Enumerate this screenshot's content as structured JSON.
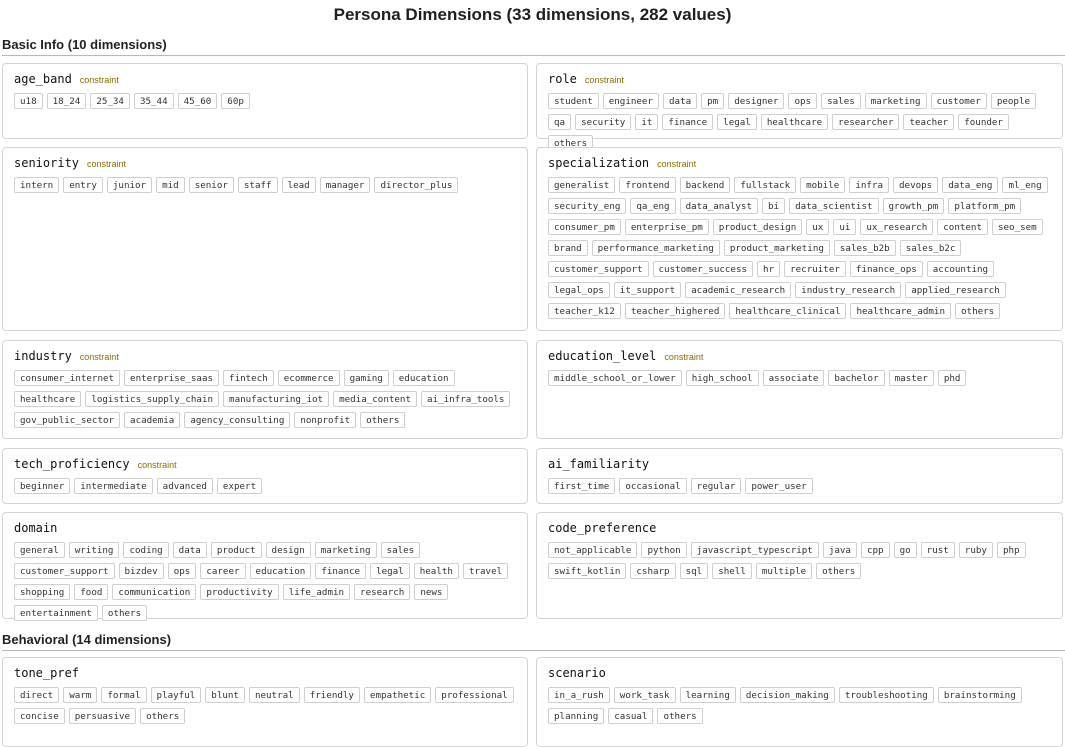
{
  "title": "Persona Dimensions (33 dimensions, 282 values)",
  "sections": [
    {
      "label": "Basic Info (10 dimensions)",
      "rows": [
        [
          {
            "name": "age_band",
            "constraint": "constraint",
            "values": [
              "u18",
              "18_24",
              "25_34",
              "35_44",
              "45_60",
              "60p"
            ]
          },
          {
            "name": "role",
            "constraint": "constraint",
            "values": [
              "student",
              "engineer",
              "data",
              "pm",
              "designer",
              "ops",
              "sales",
              "marketing",
              "customer",
              "people",
              "qa",
              "security",
              "it",
              "finance",
              "legal",
              "healthcare",
              "researcher",
              "teacher",
              "founder",
              "others"
            ]
          }
        ],
        [
          {
            "name": "seniority",
            "constraint": "constraint",
            "values": [
              "intern",
              "entry",
              "junior",
              "mid",
              "senior",
              "staff",
              "lead",
              "manager",
              "director_plus"
            ]
          },
          {
            "name": "specialization",
            "constraint": "constraint",
            "values": [
              "generalist",
              "frontend",
              "backend",
              "fullstack",
              "mobile",
              "infra",
              "devops",
              "data_eng",
              "ml_eng",
              "security_eng",
              "qa_eng",
              "data_analyst",
              "bi",
              "data_scientist",
              "growth_pm",
              "platform_pm",
              "consumer_pm",
              "enterprise_pm",
              "product_design",
              "ux",
              "ui",
              "ux_research",
              "content",
              "seo_sem",
              "brand",
              "performance_marketing",
              "product_marketing",
              "sales_b2b",
              "sales_b2c",
              "customer_support",
              "customer_success",
              "hr",
              "recruiter",
              "finance_ops",
              "accounting",
              "legal_ops",
              "it_support",
              "academic_research",
              "industry_research",
              "applied_research",
              "teacher_k12",
              "teacher_highered",
              "healthcare_clinical",
              "healthcare_admin",
              "others"
            ]
          }
        ],
        [
          {
            "name": "industry",
            "constraint": "constraint",
            "values": [
              "consumer_internet",
              "enterprise_saas",
              "fintech",
              "ecommerce",
              "gaming",
              "education",
              "healthcare",
              "logistics_supply_chain",
              "manufacturing_iot",
              "media_content",
              "ai_infra_tools",
              "gov_public_sector",
              "academia",
              "agency_consulting",
              "nonprofit",
              "others"
            ]
          },
          {
            "name": "education_level",
            "constraint": "constraint",
            "values": [
              "middle_school_or_lower",
              "high_school",
              "associate",
              "bachelor",
              "master",
              "phd"
            ]
          }
        ],
        [
          {
            "name": "tech_proficiency",
            "constraint": "constraint",
            "values": [
              "beginner",
              "intermediate",
              "advanced",
              "expert"
            ]
          },
          {
            "name": "ai_familiarity",
            "constraint": "",
            "values": [
              "first_time",
              "occasional",
              "regular",
              "power_user"
            ]
          }
        ],
        [
          {
            "name": "domain",
            "constraint": "",
            "values": [
              "general",
              "writing",
              "coding",
              "data",
              "product",
              "design",
              "marketing",
              "sales",
              "customer_support",
              "bizdev",
              "ops",
              "career",
              "education",
              "finance",
              "legal",
              "health",
              "travel",
              "shopping",
              "food",
              "communication",
              "productivity",
              "life_admin",
              "research",
              "news",
              "entertainment",
              "others"
            ]
          },
          {
            "name": "code_preference",
            "constraint": "",
            "values": [
              "not_applicable",
              "python",
              "javascript_typescript",
              "java",
              "cpp",
              "go",
              "rust",
              "ruby",
              "php",
              "swift_kotlin",
              "csharp",
              "sql",
              "shell",
              "multiple",
              "others"
            ]
          }
        ]
      ]
    },
    {
      "label": "Behavioral (14 dimensions)",
      "rows": [
        [
          {
            "name": "tone_pref",
            "constraint": "",
            "values": [
              "direct",
              "warm",
              "formal",
              "playful",
              "blunt",
              "neutral",
              "friendly",
              "empathetic",
              "professional",
              "concise",
              "persuasive",
              "others"
            ]
          },
          {
            "name": "scenario",
            "constraint": "",
            "values": [
              "in_a_rush",
              "work_task",
              "learning",
              "decision_making",
              "troubleshooting",
              "brainstorming",
              "planning",
              "casual",
              "others"
            ]
          }
        ]
      ]
    }
  ]
}
